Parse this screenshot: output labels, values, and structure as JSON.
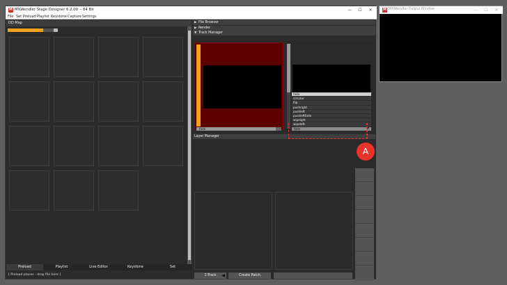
{
  "main_window": {
    "title": "MXWendler Stage Designer 6.2.00 -- 64 Bit",
    "controls": {
      "minimize": "—",
      "maximize": "☐",
      "close": "✕"
    }
  },
  "menu": [
    "File",
    "Set",
    "Preload",
    "Playlist",
    "Keystone",
    "Capture",
    "Settings"
  ],
  "dd_map": {
    "title": "DD Map",
    "progress_fraction": 0.73
  },
  "left_tabs": [
    {
      "label": "Preload",
      "active": true
    },
    {
      "label": "Playlist",
      "active": false
    },
    {
      "label": "Live Editor",
      "active": false
    },
    {
      "label": "Keystone",
      "active": false
    },
    {
      "label": "Set",
      "active": false
    }
  ],
  "status_text": "[ Preload places - drop file here ]",
  "sections": {
    "file_browser": "File Browser",
    "render": "Render",
    "track_manager": "Track Manager",
    "layer_manager": "Layer Manager"
  },
  "track_a": {
    "effect": "fade"
  },
  "track_b": {
    "effect": "fade",
    "options": [
      "fade",
      "circular",
      "flip",
      "pushright",
      "pushleft",
      "pushleftfade",
      "wipeight",
      "wipeleft"
    ],
    "selected_index": 0
  },
  "layer_buttons": {
    "track": "1-Track",
    "create_patch": "Create Patch"
  },
  "output_window": {
    "title": "MXWendler Output Window"
  },
  "annotation": {
    "label": "A",
    "color": "#e8332b"
  },
  "colors": {
    "accent_orange": "#f3a21f",
    "track_red": "#5d0000"
  },
  "icons": {
    "logo": "mxw-logo-icon"
  }
}
